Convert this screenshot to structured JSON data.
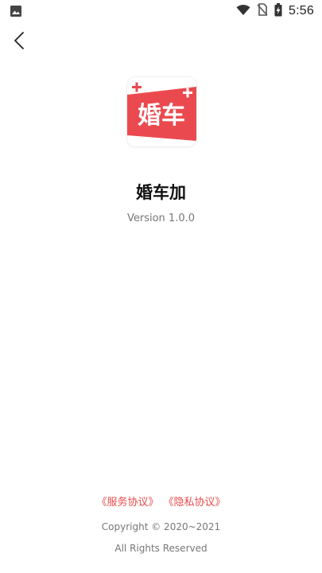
{
  "status_bar": {
    "time": "5:56",
    "left_icon": "image-icon",
    "icons": [
      "wifi-icon",
      "no-sim-icon",
      "battery-charging-icon"
    ]
  },
  "app_bar": {
    "back_icon": "chevron-left-icon"
  },
  "app": {
    "logo_text": "婚车",
    "name": "婚车加",
    "version": "Version 1.0.0",
    "brand_color": "#ea4a4f"
  },
  "footer": {
    "service_agreement": "《服务协议》",
    "privacy_agreement": "《隐私协议》",
    "copyright": "Copyright © 2020~2021",
    "rights": "All Rights Reserved",
    "link_color": "#e94b4b"
  }
}
